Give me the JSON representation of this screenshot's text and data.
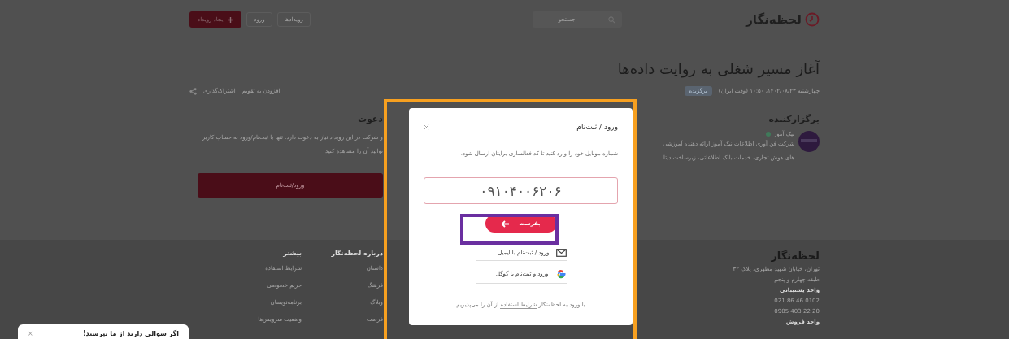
{
  "header": {
    "logo": "لحظه‌نگار",
    "search": {
      "placeholder": "جستجو"
    },
    "nav": [
      "رویدادها",
      "ورود"
    ],
    "create_button": "ایجاد رویداد"
  },
  "event": {
    "title": "آغاز مسیر شغلی به روایت داده‌ها",
    "datetime": "چهارشنبه ۱۴۰۲/۰۸/۲۳، ۱۰:۵۰ (وقت ایران)",
    "tag": "برگزیده",
    "actions": [
      "افزودن به تقویم",
      "اشتراک‌گذاری"
    ]
  },
  "organizer": {
    "heading": "برگزارکننده",
    "name": "نیک آموز",
    "description": [
      "شرکت فن آوری اطلاعات نیک آموز ارائه دهنده آموزشی",
      "های هوش تجاری، خدمات بانک اطلاعاتی، زیرساخت دیتا"
    ]
  },
  "invite": {
    "heading": "دعوت",
    "text": [
      "و شرکت در این رویداد نیاز به دعوت دارد. تنها با ثبت‌نام/ورود به حساب کاربر",
      "توانید آن را مشاهده کنید"
    ],
    "button": "ورود/ثبت‌نام"
  },
  "footer": {
    "brand": "لحظه‌نگار",
    "address": [
      "تهران، خیابان شهید مطهری، پلاک ۳۲",
      "طبقه چهارم و پنجم"
    ],
    "contacts": [
      {
        "label": "واحد پشتیبانی",
        "numbers": [
          "021 86 46 0102",
          "0905 403 22 20"
        ]
      },
      {
        "label": "واحد فروش"
      }
    ],
    "columns": [
      {
        "heading": "درباره لحظه‌نگار",
        "items": [
          "داستان",
          "فرهنگ",
          "وبلاگ",
          "فرصت"
        ]
      },
      {
        "heading": "بیشتر",
        "items": [
          "شرایط استفاده",
          "حریم خصوصی",
          "برنامه‌نویسان",
          "وضعیت سرویس‌ها"
        ]
      }
    ]
  },
  "modal": {
    "title": "ورود / ثبت‌نام",
    "instruction": "شماره موبایل خود را وارد کنید تا کد فعالسازی برایتان ارسال شود.",
    "phone": "۰۹۱۰۴۰۰۶۲۰۶",
    "submit": "بفرست",
    "options": [
      {
        "kind": "email",
        "label": "ورود / ثبت‌نام با ایمیل"
      },
      {
        "kind": "google",
        "label": "ورود و ثبت‌نام با گوگل"
      }
    ],
    "terms": {
      "before": "با ورود به لحظه‌نگار",
      "link": "شرایط استفاده",
      "after": "از آن را می‌پذیریم"
    }
  },
  "chat": {
    "text": "اگر سوالی دارید از ما بپرسید!",
    "close": "×"
  }
}
